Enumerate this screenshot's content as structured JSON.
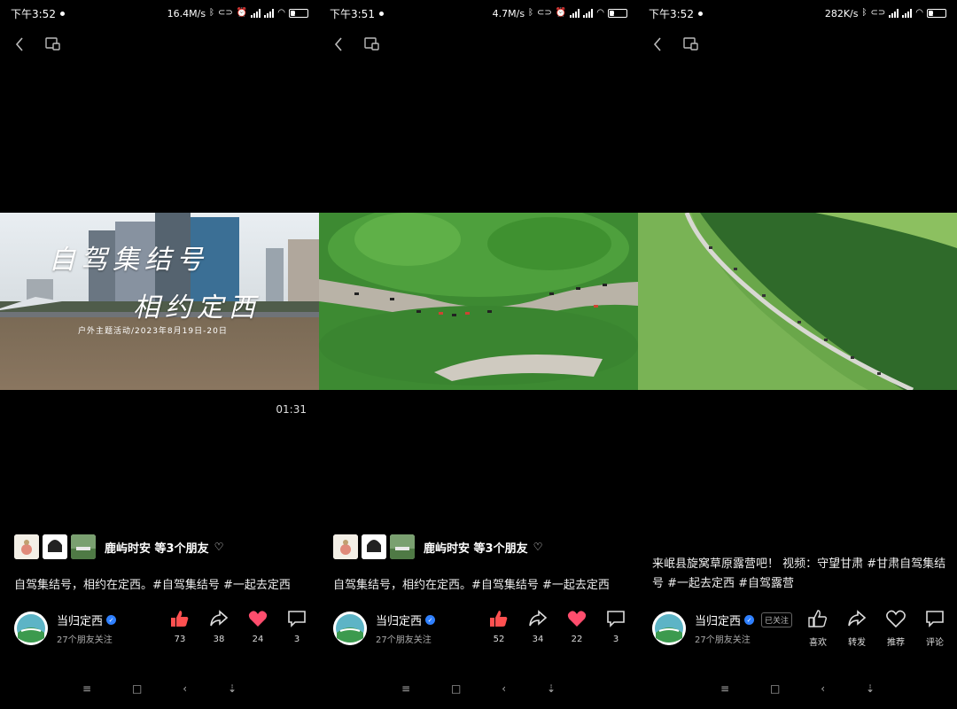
{
  "panels": [
    {
      "status": {
        "time": "下午3:52",
        "speed": "16.4M/s",
        "battery": "27"
      },
      "duration": "01:31",
      "overlay": {
        "title_line1": "自驾集结号",
        "title_line2": "相约定西",
        "subtitle": "户外主题活动/2023年8月19日-20日"
      },
      "friends_text": "鹿屿时安 等3个朋友",
      "caption": "自驾集结号，相约在定西。#自驾集结号 #一起去定西",
      "author": {
        "name": "当归定西",
        "followers": "27个朋友关注"
      },
      "actions": {
        "likes": "73",
        "shares": "38",
        "hearts": "24",
        "comments": "3"
      }
    },
    {
      "status": {
        "time": "下午3:51",
        "speed": "4.7M/s",
        "battery": "27"
      },
      "friends_text": "鹿屿时安 等3个朋友",
      "caption": "自驾集结号，相约在定西。#自驾集结号 #一起去定西",
      "author": {
        "name": "当归定西",
        "followers": "27个朋友关注"
      },
      "actions": {
        "likes": "52",
        "shares": "34",
        "hearts": "22",
        "comments": "3"
      }
    },
    {
      "status": {
        "time": "下午3:52",
        "speed": "282K/s",
        "battery": "26"
      },
      "caption": "来岷县旋窝草原露营吧！ 视频：守望甘肃 #甘肃自驾集结号 #一起去定西 #自驾露营",
      "author": {
        "name": "当归定西",
        "followers": "27个朋友关注",
        "followed_badge": "已关注"
      },
      "actions": {
        "like_label": "喜欢",
        "share_label": "转发",
        "recommend_label": "推荐",
        "comment_label": "评论"
      }
    }
  ],
  "colors": {
    "like": "#ff5050",
    "heart": "#ff4d6d",
    "verified": "#2f80ff"
  },
  "icons": [
    "back-icon",
    "window-icon",
    "thumb-up-icon",
    "share-icon",
    "heart-icon",
    "comment-icon",
    "menu-icon",
    "home-icon",
    "back-nav-icon",
    "down-arrow-icon"
  ]
}
